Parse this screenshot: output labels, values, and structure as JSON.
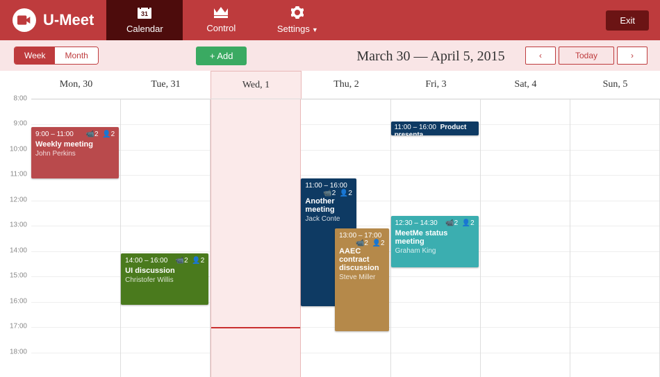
{
  "app": {
    "name": "U-Meet"
  },
  "nav": {
    "calendar": "Calendar",
    "control": "Control",
    "settings": "Settings",
    "exit": "Exit"
  },
  "toolbar": {
    "week": "Week",
    "month": "Month",
    "add": "+  Add",
    "range": "March 30 — April 5, 2015",
    "prev": "‹",
    "today": "Today",
    "next": "›"
  },
  "days": [
    {
      "label": "Mon, 30"
    },
    {
      "label": "Tue, 31"
    },
    {
      "label": "Wed, 1"
    },
    {
      "label": "Thu, 2"
    },
    {
      "label": "Fri, 3"
    },
    {
      "label": "Sat, 4"
    },
    {
      "label": "Sun, 5"
    }
  ],
  "hours": [
    "8:00",
    "9:00",
    "10:00",
    "11:00",
    "12:00",
    "13:00",
    "14:00",
    "15:00",
    "16:00",
    "17:00",
    "18:00"
  ],
  "today_index": 2,
  "now_offset_pct": 82,
  "events": [
    {
      "day": 0,
      "color": "red",
      "time": "9:00 – 11:00",
      "title": "Weekly meeting",
      "organizer": "John Perkins",
      "cam": 2,
      "ppl": 2,
      "top_pct": 10.0,
      "height_pct": 18.5
    },
    {
      "day": 1,
      "color": "green",
      "time": "14:00 – 16:00",
      "title": "UI discussion",
      "organizer": "Christofer Willis",
      "cam": 2,
      "ppl": 2,
      "top_pct": 55.5,
      "height_pct": 18.5
    },
    {
      "day": 3,
      "color": "navy",
      "time": "11:00 – 16:00",
      "title": "Another meeting",
      "organizer": "Jack Conte",
      "cam": 2,
      "ppl": 2,
      "top_pct": 28.5,
      "height_pct": 46.0,
      "half": "left"
    },
    {
      "day": 3,
      "color": "brown",
      "time": "13:00 – 17:00",
      "title": "AAEC contract discussion",
      "organizer": "Steve Miller",
      "cam": 2,
      "ppl": 2,
      "top_pct": 46.5,
      "height_pct": 37.0,
      "half": "right"
    },
    {
      "day": 4,
      "color": "navy-sm",
      "time": "11:00 – 16:00",
      "title": "Product presenta",
      "organizer": "",
      "cam": null,
      "ppl": null,
      "top_pct": 8.0,
      "height_pct": 5.0,
      "compact": true
    },
    {
      "day": 4,
      "color": "teal",
      "time": "12:30 – 14:30",
      "title": "MeetMe status meeting",
      "organizer": "Graham King",
      "cam": 2,
      "ppl": 2,
      "top_pct": 42.0,
      "height_pct": 18.5
    }
  ]
}
